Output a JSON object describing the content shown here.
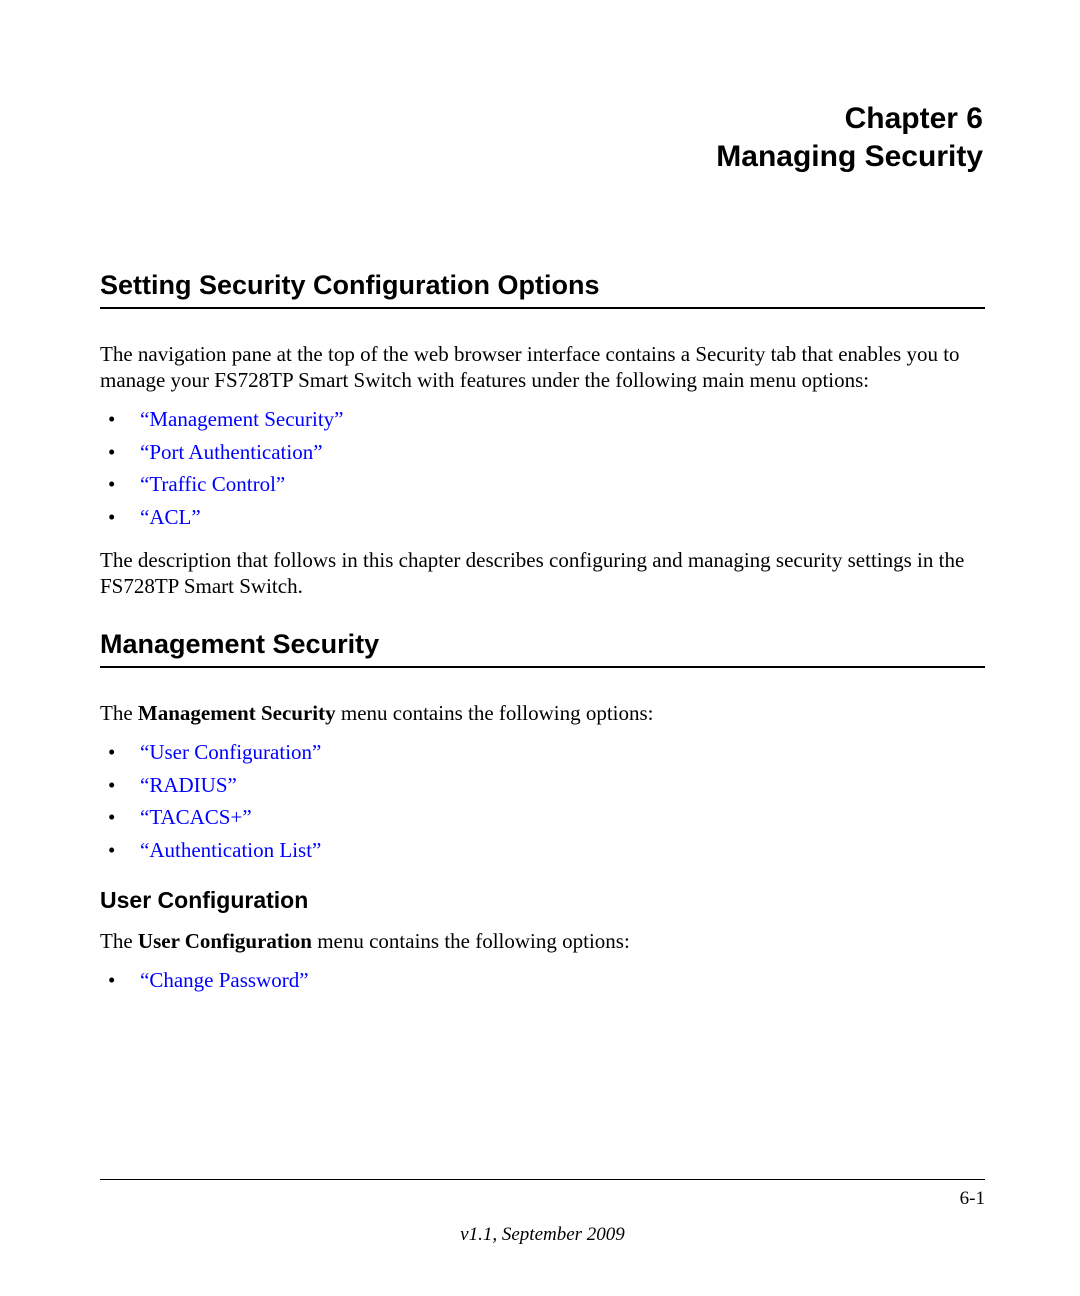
{
  "chapter": {
    "number_line": "Chapter 6",
    "title_line": "Managing Security"
  },
  "section1": {
    "heading": "Setting Security Configuration Options",
    "intro": "The navigation pane at the top of the web browser interface contains a Security tab that enables you to manage your FS728TP Smart Switch with features under the following main menu options:",
    "links": [
      "“Management Security”",
      "“Port Authentication”",
      "“Traffic Control”",
      "“ACL”"
    ],
    "outro": "The description that follows in this chapter describes configuring and managing security settings in the FS728TP Smart Switch."
  },
  "section2": {
    "heading": "Management Security",
    "intro_prefix": "The ",
    "intro_bold": "Management Security",
    "intro_suffix": " menu contains the following options:",
    "links": [
      "“User Configuration”",
      "“RADIUS”",
      "“TACACS+”",
      "“Authentication List”"
    ]
  },
  "section3": {
    "heading": "User Configuration",
    "intro_prefix": "The ",
    "intro_bold": "User Configuration",
    "intro_suffix": " menu contains the following options:",
    "links": [
      "“Change Password”"
    ]
  },
  "footer": {
    "page_number": "6-1",
    "version": "v1.1, September 2009"
  }
}
